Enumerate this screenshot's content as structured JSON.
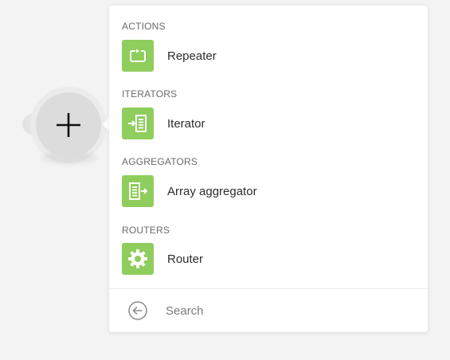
{
  "menu": {
    "sections": [
      {
        "heading": "ACTIONS",
        "item": "Repeater",
        "icon": "repeat-icon"
      },
      {
        "heading": "ITERATORS",
        "item": "Iterator",
        "icon": "iterator-icon"
      },
      {
        "heading": "AGGREGATORS",
        "item": "Array aggregator",
        "icon": "aggregator-icon"
      },
      {
        "heading": "ROUTERS",
        "item": "Router",
        "icon": "gear-icon"
      }
    ],
    "search_placeholder": "Search"
  },
  "colors": {
    "tile": "#8fcd5c",
    "panel": "#ffffff",
    "background": "#f3f3f3"
  }
}
